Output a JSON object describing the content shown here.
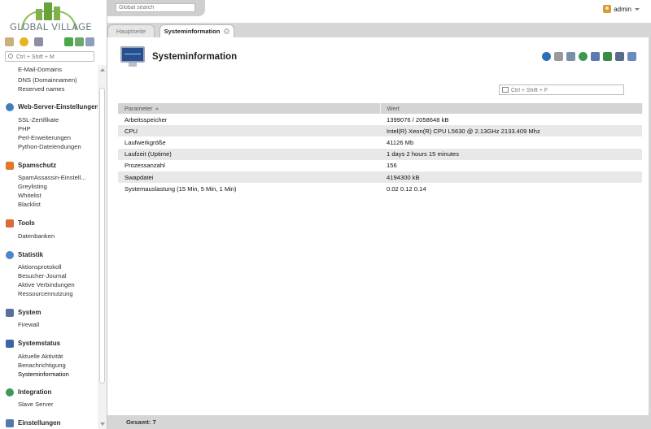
{
  "brand": {
    "logo_text": "GLOBAL VILLAGE"
  },
  "sidebar": {
    "search_placeholder": "Ctrl + Shift + M",
    "partial_top": "E-Mail-Domains",
    "links_top": [
      "DNS (Domainnamen)",
      "Reserved names"
    ],
    "sections": [
      {
        "title": "Web-Server-Einstellungen",
        "icon": "globe-icon",
        "items": [
          "SSL-Zertifikate",
          "PHP",
          "Perl-Erweiterungen",
          "Python-Dateiendungen"
        ]
      },
      {
        "title": "Spamschutz",
        "icon": "spam-shield-icon",
        "items": [
          "SpamAssassin-Einstell...",
          "Greylisting",
          "Whitelist",
          "Blacklist"
        ]
      },
      {
        "title": "Tools",
        "icon": "tools-icon",
        "items": [
          "Datenbanken"
        ]
      },
      {
        "title": "Statistik",
        "icon": "statistics-icon",
        "items": [
          "Aktionsprotokoll",
          "Besucher-Journal",
          "Aktive Verbindungen",
          "Ressourcennutzung"
        ]
      },
      {
        "title": "System",
        "icon": "system-icon",
        "items": [
          "Firewall"
        ]
      },
      {
        "title": "Systemstatus",
        "icon": "system-status-icon",
        "items": [
          "Aktuelle Aktivität",
          "Benachrichtigung",
          "Systeminformation"
        ]
      },
      {
        "title": "Integration",
        "icon": "integration-icon",
        "items": [
          "Slave Server"
        ]
      },
      {
        "title": "Einstellungen",
        "icon": "settings-icon",
        "items": []
      }
    ],
    "active_item": "Systeminformation"
  },
  "topbar": {
    "global_search_placeholder": "Global search",
    "user": "admin"
  },
  "tabs": [
    {
      "label": "Hauptseite",
      "active": false
    },
    {
      "label": "Systeminformation",
      "active": true
    }
  ],
  "page": {
    "title": "Systeminformation",
    "filter_placeholder": "Ctrl + Shift + F",
    "actions": [
      "refresh-icon",
      "favorite-star-icon",
      "pin-icon",
      "help-globe-icon",
      "export-icon",
      "export-excel-icon",
      "print-icon",
      "email-icon"
    ]
  },
  "table": {
    "columns": [
      "Parameter",
      "Wert"
    ],
    "rows": [
      [
        "Arbeitsspeicher",
        "1399076 / 2058648 kB"
      ],
      [
        "CPU",
        "Intel(R) Xeon(R) CPU L5630 @ 2.13GHz 2133.409 Mhz"
      ],
      [
        "Laufwerkgröße",
        "41126 Mb"
      ],
      [
        "Laufzeit (Uptime)",
        "1 days 2 hours 15 minutes"
      ],
      [
        "Prozessanzahl",
        "156"
      ],
      [
        "Swapdatei",
        "4194300 kB"
      ],
      [
        "Systemauslastung (15 Min, 5 Min, 1 Min)",
        "0.02 0.12 0.14"
      ]
    ]
  },
  "footer": {
    "total": "Gesamt: 7"
  },
  "colors": {
    "accent_green": "#7fb34a",
    "header_gray": "#d4d4d4",
    "alt_row": "#e8e8e8"
  }
}
